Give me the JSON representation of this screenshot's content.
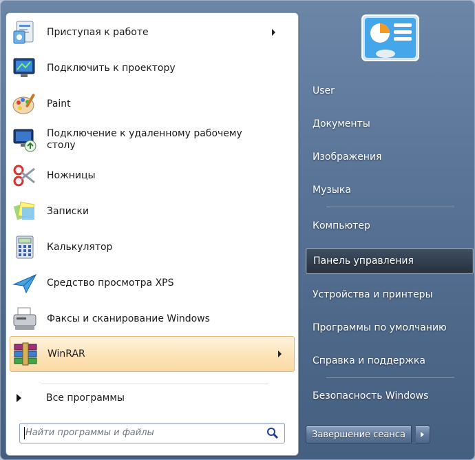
{
  "left_items": [
    {
      "label": "Приступая к работе",
      "icon": "getting-started-icon",
      "has_arrow": true
    },
    {
      "label": "Подключить к проектору",
      "icon": "projector-icon",
      "has_arrow": false
    },
    {
      "label": "Paint",
      "icon": "paint-icon",
      "has_arrow": false
    },
    {
      "label_line1": "Подключение к удаленному рабочему",
      "label_line2": "столу",
      "icon": "remote-desktop-icon",
      "has_arrow": false
    },
    {
      "label": "Ножницы",
      "icon": "scissors-icon",
      "has_arrow": false
    },
    {
      "label": "Записки",
      "icon": "sticky-notes-icon",
      "has_arrow": false
    },
    {
      "label": "Калькулятор",
      "icon": "calculator-icon",
      "has_arrow": false
    },
    {
      "label": "Средство просмотра XPS",
      "icon": "xps-viewer-icon",
      "has_arrow": false
    },
    {
      "label": "Факсы и сканирование Windows",
      "icon": "fax-scanner-icon",
      "has_arrow": false
    },
    {
      "label": "WinRAR",
      "icon": "winrar-icon",
      "has_arrow": true,
      "highlighted": true
    }
  ],
  "all_programs": {
    "label": "Все программы"
  },
  "search": {
    "placeholder": "Найти программы и файлы"
  },
  "right_items": [
    {
      "label": "User"
    },
    {
      "label": "Документы"
    },
    {
      "label": "Изображения"
    },
    {
      "label": "Музыка"
    },
    {
      "label": "Компьютер"
    },
    {
      "label": "Панель управления",
      "highlighted": true
    },
    {
      "label": "Устройства и принтеры"
    },
    {
      "label": "Программы по умолчанию"
    },
    {
      "label": "Справка и поддержка"
    },
    {
      "label": "Безопасность Windows"
    }
  ],
  "shutdown": {
    "label": "Завершение сеанса"
  },
  "colors": {
    "highlight_left": "#fbd9a4",
    "menu_bg": "#5b7699",
    "highlight_right": "#27313d"
  }
}
